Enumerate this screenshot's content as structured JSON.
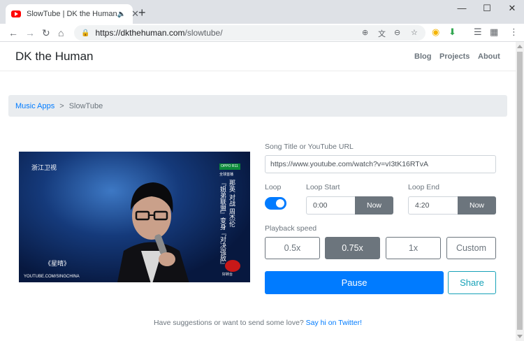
{
  "browser": {
    "tab_title": "SlowTube | DK the Human",
    "tab_audio_icon": "speaker-icon",
    "tab_close": "✕",
    "new_tab": "+",
    "window": {
      "minimize": "—",
      "maximize": "☐",
      "close": "✕"
    },
    "url_host": "https://dkthehuman.com",
    "url_path": "/slowtube/"
  },
  "navbar": {
    "brand": "DK the Human",
    "links": [
      "Blog",
      "Projects",
      "About"
    ]
  },
  "breadcrumb": {
    "parent": "Music Apps",
    "separator": ">",
    "current": "SlowTube"
  },
  "video": {
    "channel": "浙江卫视",
    "sponsor": "OPPO R11",
    "live_label": "全球首播",
    "caption_right": "那英 对战 周杰伦",
    "caption_left": "『姐弟联盟』变身『对决强敌』",
    "song": "《星晴》",
    "watermark": "YOUTUBE.COM/SINGCHINA",
    "cam_label": "好转台"
  },
  "form": {
    "url_label": "Song Title or YouTube URL",
    "url_value": "https://www.youtube.com/watch?v=vI3tK16RTvA",
    "loop_label": "Loop",
    "loop_enabled": true,
    "loop_start_label": "Loop Start",
    "loop_start_value": "0:00",
    "loop_end_label": "Loop End",
    "loop_end_value": "4:20",
    "now_label": "Now",
    "speed_label": "Playback speed",
    "speeds": [
      "0.5x",
      "0.75x",
      "1x",
      "Custom"
    ],
    "active_speed": "0.75x",
    "pause_label": "Pause",
    "share_label": "Share"
  },
  "footer": {
    "text": "Have suggestions or want to send some love?",
    "link": "Say hi on Twitter!"
  },
  "colors": {
    "primary": "#007bff",
    "secondary": "#6c757d",
    "info": "#17a2b8",
    "youtube_red": "#ff0000"
  }
}
